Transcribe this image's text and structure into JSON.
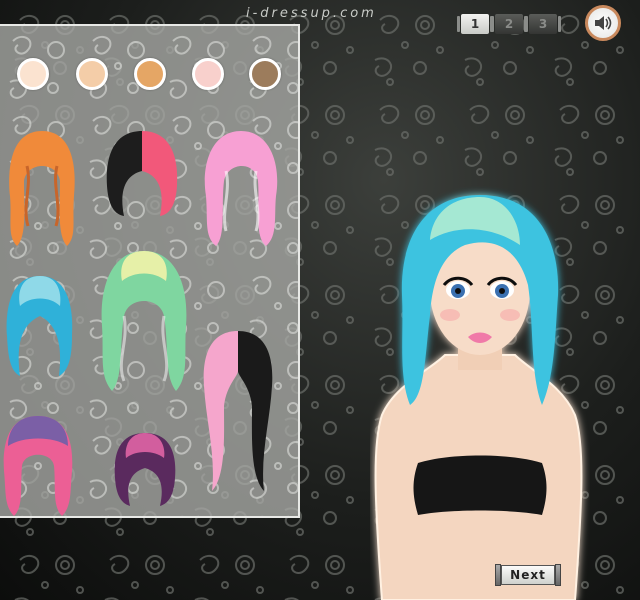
{
  "header": {
    "site_logo": "i-dressup.com",
    "page_tabs": [
      {
        "label": "1",
        "active": true
      },
      {
        "label": "2",
        "active": false
      },
      {
        "label": "3",
        "active": false
      }
    ],
    "sound_icon": "speaker-icon"
  },
  "skin_swatches": [
    {
      "name": "skin-pale",
      "color": "#fbe3d0"
    },
    {
      "name": "skin-light",
      "color": "#f4cda8"
    },
    {
      "name": "skin-tan",
      "color": "#e5a665"
    },
    {
      "name": "skin-pink",
      "color": "#f8d0cc"
    },
    {
      "name": "skin-brown",
      "color": "#9c7c5c"
    }
  ],
  "hairstyles": [
    {
      "name": "hair-orange-curly",
      "colors": [
        "#f08a3a",
        "#f5b55a"
      ]
    },
    {
      "name": "hair-black-pink-bob",
      "colors": [
        "#1d1d1d",
        "#f2587a"
      ]
    },
    {
      "name": "hair-pink-wavy",
      "colors": [
        "#f7a0d3",
        "#f3c3e6"
      ]
    },
    {
      "name": "hair-blue-bob",
      "colors": [
        "#2fb1d9",
        "#8fd9e8"
      ]
    },
    {
      "name": "hair-green-long-wavy",
      "colors": [
        "#7fd6a0",
        "#e6f0a8"
      ]
    },
    {
      "name": "hair-pink-black-curly",
      "colors": [
        "#1a1a1a",
        "#f5a6cc"
      ]
    },
    {
      "name": "hair-purple-pink-curly",
      "colors": [
        "#7b5fa6",
        "#ec5f95"
      ]
    },
    {
      "name": "hair-purple-bob",
      "colors": [
        "#5a2a5e",
        "#d25e9e"
      ]
    }
  ],
  "character": {
    "hair_color": "#3dc3e0",
    "top_color": "#161616"
  },
  "footer": {
    "next_label": "Next"
  }
}
